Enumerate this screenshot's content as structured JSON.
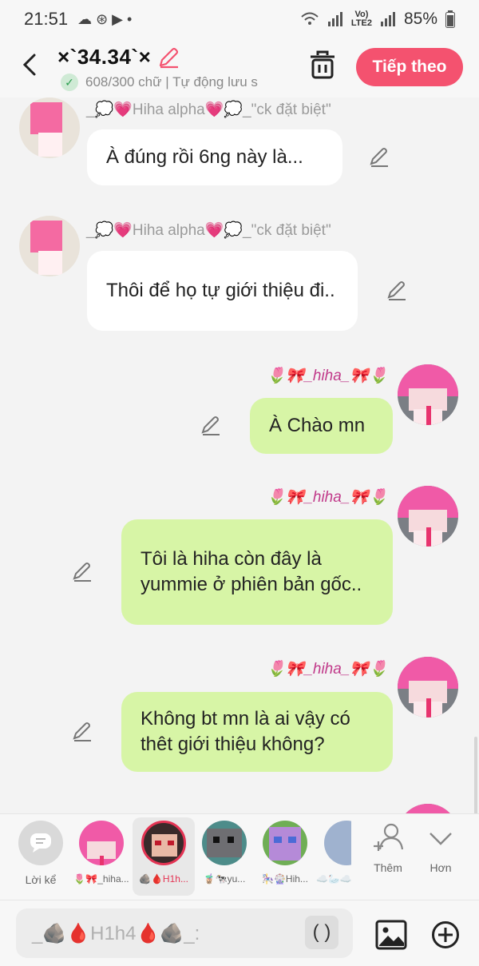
{
  "status_bar": {
    "time": "21:51",
    "left_glyphs": "☁ ⊛ ▶ •",
    "net_top": "Vo)",
    "net_bottom": "LTE2",
    "battery": "85%"
  },
  "header": {
    "title": "×`34.34`×",
    "word_count": "608/300 chữ | Tự động lưu s",
    "next_label": "Tiếp theo"
  },
  "messages": [
    {
      "side": "left",
      "name": "_💭💗Hiha alpha💗💭_\"ck đặt biệt\"",
      "text": "À đúng rồi 6ng này là..."
    },
    {
      "side": "left",
      "name": "_💭💗Hiha alpha💗💭_\"ck đặt biệt\"",
      "text": "Thôi để họ tự giới thiệu đi.."
    },
    {
      "side": "right",
      "name": "🌷🎀_hiha_🎀🌷",
      "text": "À Chào mn"
    },
    {
      "side": "right",
      "name": "🌷🎀_hiha_🎀🌷",
      "text": "Tôi là hiha còn đây là yummie ở phiên bản gốc.."
    },
    {
      "side": "right",
      "name": "🌷🎀_hiha_🎀🌷",
      "text": "Không bt mn là ai vậy có thêt giới thiệu không?"
    }
  ],
  "selector": {
    "narrator_label": "Lời kể",
    "characters": [
      {
        "label": "🌷🎀_hiha..."
      },
      {
        "label": "🪨🩸H1h..."
      },
      {
        "label": "🧋🐄yu..."
      },
      {
        "label": "🎠🎡Hih..."
      },
      {
        "label": "☁️🦢☁️"
      }
    ],
    "more_label": "Thêm",
    "expand_label": "Hơn"
  },
  "input": {
    "placeholder": "_🪨🩸H1h4🩸🪨_:",
    "paren_label": "( )"
  },
  "colors": {
    "accent": "#f4526f",
    "bubble_out": "#d7f5a6",
    "bubble_in": "#ffffff",
    "active_label": "#e43454"
  }
}
